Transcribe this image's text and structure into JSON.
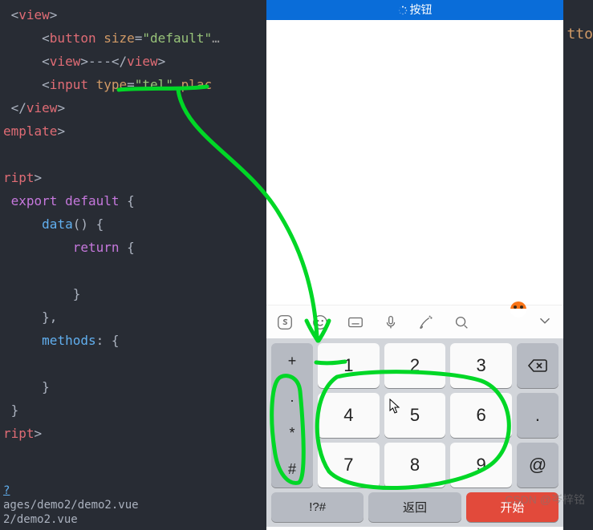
{
  "editor": {
    "l1_tag": "view",
    "l2_tag": "button",
    "l2_attr": "size",
    "l2_val": "\"default\"",
    "l3_tag": "view",
    "l3_text": "---",
    "l4_tag": "input",
    "l4_attr": "type",
    "l4_val": "\"tel\"",
    "l4_attr2": "plac",
    "l5_close": "view",
    "l6": "emplate",
    "l7": "ript",
    "l8a": "export",
    "l8b": "default",
    "l8c": "{",
    "l9": "data",
    "l9p": "() {",
    "l10": "return",
    "l10b": " {",
    "l11": "}",
    "l12": "},",
    "l13": "methods",
    "l13b": ": {",
    "l14": "}",
    "l15": "}",
    "l16": "ript"
  },
  "terminal": {
    "line1": "ages/demo2/demo2.vue",
    "line2": "2/demo2.vue"
  },
  "header": {
    "title": "按钮"
  },
  "right_snippet": {
    "text": "tto"
  },
  "keys": {
    "plus": "+",
    "dot": ".",
    "star": "*",
    "hash": "#",
    "k1": "1",
    "k2": "2",
    "k3": "3",
    "k4": "4",
    "k5": "5",
    "k6": "6",
    "k7": "7",
    "k8": "8",
    "k9": "9",
    "period": ".",
    "at": "@",
    "sym": "!?#",
    "back": "返回",
    "start": "开始"
  },
  "watermark": "CSDN @岑梓铭"
}
